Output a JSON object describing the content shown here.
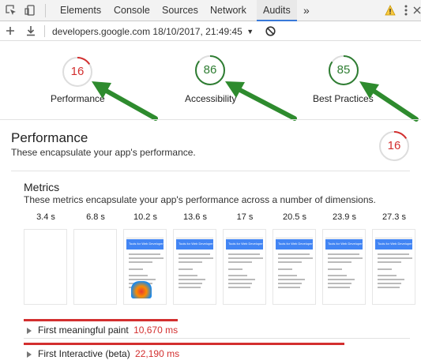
{
  "tabs": [
    {
      "label": "Elements"
    },
    {
      "label": "Console"
    },
    {
      "label": "Sources"
    },
    {
      "label": "Network"
    },
    {
      "label": "Audits"
    }
  ],
  "active_tab": "Audits",
  "overflow_label": "»",
  "url_bar": {
    "text": "developers.google.com 18/10/2017, 21:49:45"
  },
  "gauges": [
    {
      "score": "16",
      "label": "Performance",
      "color": "#d32f2f",
      "fraction": 0.16
    },
    {
      "score": "86",
      "label": "Accessibility",
      "color": "#2e7d32",
      "fraction": 0.86
    },
    {
      "score": "85",
      "label": "Best Practices",
      "color": "#2e7d32",
      "fraction": 0.85
    }
  ],
  "section": {
    "title": "Performance",
    "description": "These encapsulate your app's performance.",
    "score": "16",
    "score_color": "#d32f2f",
    "score_fraction": 0.16
  },
  "metrics": {
    "title": "Metrics",
    "description": "These metrics encapsulate your app's performance across a number of dimensions.",
    "timestamps": [
      "3.4 s",
      "6.8 s",
      "10.2 s",
      "13.6 s",
      "17 s",
      "20.5 s",
      "23.9 s",
      "27.3 s"
    ],
    "thumbnail_title": "Tools for Web Developers",
    "rows": [
      {
        "label": "First meaningful paint",
        "value": "10,670 ms"
      },
      {
        "label": "First Interactive (beta)",
        "value": "22,190 ms"
      }
    ]
  },
  "colors": {
    "red": "#d32f2f",
    "green": "#2e7d32",
    "arrow": "#2e8b2e",
    "accent": "#3879d9"
  }
}
